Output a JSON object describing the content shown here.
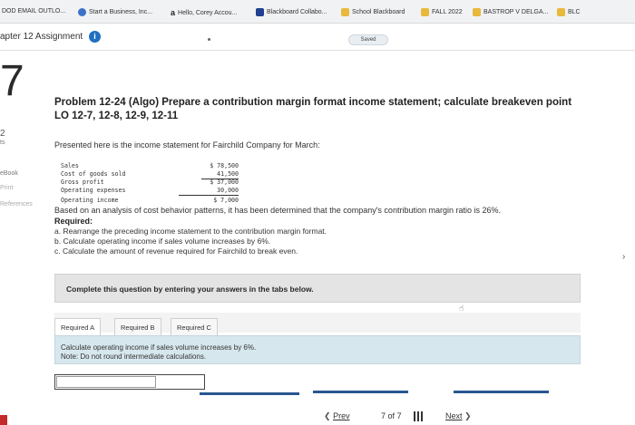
{
  "bookmarks": [
    {
      "label": "DOD EMAIL OUTLO...",
      "icon": "none"
    },
    {
      "label": "Start a Business, Inc...",
      "icon": "star-icon"
    },
    {
      "label": "Hello, Corey Accou...",
      "icon": "amazon-icon"
    },
    {
      "label": "Blackboard Collabo...",
      "icon": "blackboard-icon"
    },
    {
      "label": "School Blackboard",
      "icon": "folder-icon"
    },
    {
      "label": "FALL 2022",
      "icon": "folder-icon"
    },
    {
      "label": "BASTROP V DELGA...",
      "icon": "folder-icon"
    },
    {
      "label": "BLC",
      "icon": "folder-icon"
    }
  ],
  "assignment": {
    "title": "apter 12 Assignment",
    "info_icon": "i",
    "saved_label": "Saved"
  },
  "left_strip": {
    "question_number": "7",
    "points": "2",
    "points_label": "ts",
    "ebook": "eBook",
    "print": "Print",
    "references": "References"
  },
  "problem": {
    "title": "Problem 12-24 (Algo) Prepare a contribution margin format income statement; calculate breakeven point LO 12-7, 12-8, 12-9, 12-11",
    "presented": "Presented here is the income statement for Fairchild Company for March:",
    "income_statement": [
      {
        "label": "Sales",
        "value": "$ 78,500"
      },
      {
        "label": "Cost of goods sold",
        "value": "41,500"
      },
      {
        "label": "Gross profit",
        "value": "$ 37,000"
      },
      {
        "label": "Operating expenses",
        "value": "30,000"
      },
      {
        "label": "Operating income",
        "value": "$ 7,000"
      }
    ],
    "analysis": "Based on an analysis of cost behavior patterns, it has been determined that the company's contribution margin ratio is 26%.",
    "required_heading": "Required:",
    "requirements": [
      "a. Rearrange the preceding income statement to the contribution margin format.",
      "b. Calculate operating income if sales volume increases by 6%.",
      "c. Calculate the amount of revenue required for Fairchild to break even."
    ]
  },
  "instructions": "Complete this question by entering your answers in the tabs below.",
  "tabs": [
    "Required A",
    "Required B",
    "Required C"
  ],
  "active_tab": "Required A",
  "task": {
    "line1": "Calculate operating income if sales volume increases by 6%.",
    "line2": "Note: Do not round intermediate calculations."
  },
  "navigation": {
    "prev_label": "Prev",
    "current_page": "7",
    "of_label": "of",
    "total_pages": "7",
    "next_label": "Next",
    "prev_arrow": "❮",
    "next_arrow": "❯"
  },
  "colors": {
    "accent": "#27578f",
    "info_icon": "#1f70c1",
    "task_box": "#d6e7ee",
    "instruction_box": "#e4e4e4"
  }
}
